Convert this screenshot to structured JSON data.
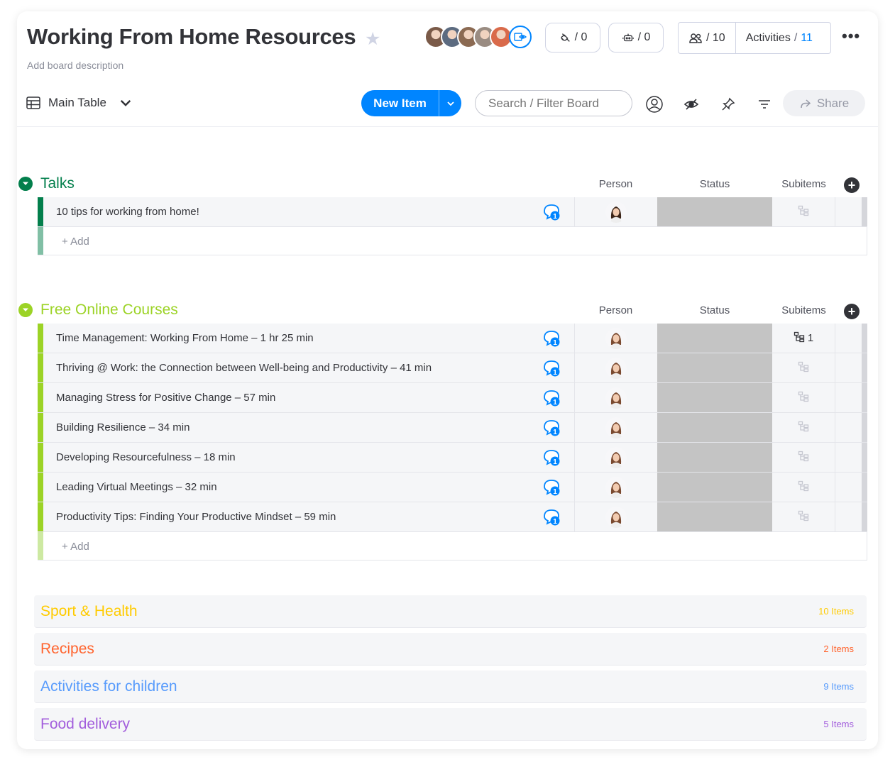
{
  "board": {
    "title": "Working From Home Resources",
    "description": "Add board description"
  },
  "header": {
    "integrations_count": "/ 0",
    "automations_count": "/ 0",
    "members_count": "/ 10",
    "activities_label": "Activities",
    "activities_separator": "/",
    "activities_count": "11",
    "avatar_colors": [
      "#7a5a48",
      "#5c6b80",
      "#8b6a52",
      "#9a8c82",
      "#d96a4a"
    ]
  },
  "toolbar": {
    "view_label": "Main Table",
    "new_item_label": "New Item",
    "search_placeholder": "Search / Filter Board",
    "share_label": "Share"
  },
  "columns": {
    "person": "Person",
    "status": "Status",
    "subitems": "Subitems"
  },
  "groups": [
    {
      "title": "Talks",
      "color": "#037f4c",
      "add_bar_color": "#81bfa5",
      "add_label": "+ Add",
      "rows": [
        {
          "name": "10 tips for working from home!",
          "updates": "1",
          "subitems": ""
        }
      ]
    },
    {
      "title": "Free Online Courses",
      "color": "#9cd326",
      "add_bar_color": "#cde9a2",
      "add_label": "+ Add",
      "rows": [
        {
          "name": "Time Management: Working From Home – 1 hr 25 min",
          "updates": "1",
          "subitems": "1"
        },
        {
          "name": "Thriving @ Work: the Connection between Well-being and Productivity – 41 min",
          "updates": "1",
          "subitems": ""
        },
        {
          "name": "Managing Stress for Positive Change – 57 min",
          "updates": "1",
          "subitems": ""
        },
        {
          "name": "Building Resilience – 34 min",
          "updates": "1",
          "subitems": ""
        },
        {
          "name": "Developing Resourcefulness – 18 min",
          "updates": "1",
          "subitems": ""
        },
        {
          "name": "Leading Virtual Meetings – 32 min",
          "updates": "1",
          "subitems": ""
        },
        {
          "name": "Productivity Tips: Finding Your Productive Mindset – 59 min",
          "updates": "1",
          "subitems": ""
        }
      ]
    }
  ],
  "collapsed_groups": [
    {
      "title": "Sport & Health",
      "count": "10 Items",
      "color": "#ffcb00"
    },
    {
      "title": "Recipes",
      "count": "2 Items",
      "color": "#ff642e"
    },
    {
      "title": "Activities for children",
      "count": "9 Items",
      "color": "#579bfc"
    },
    {
      "title": "Food delivery",
      "count": "5 Items",
      "color": "#a25ddc"
    }
  ],
  "colors": {
    "primary": "#0085ff",
    "status_empty": "#c4c4c4"
  }
}
